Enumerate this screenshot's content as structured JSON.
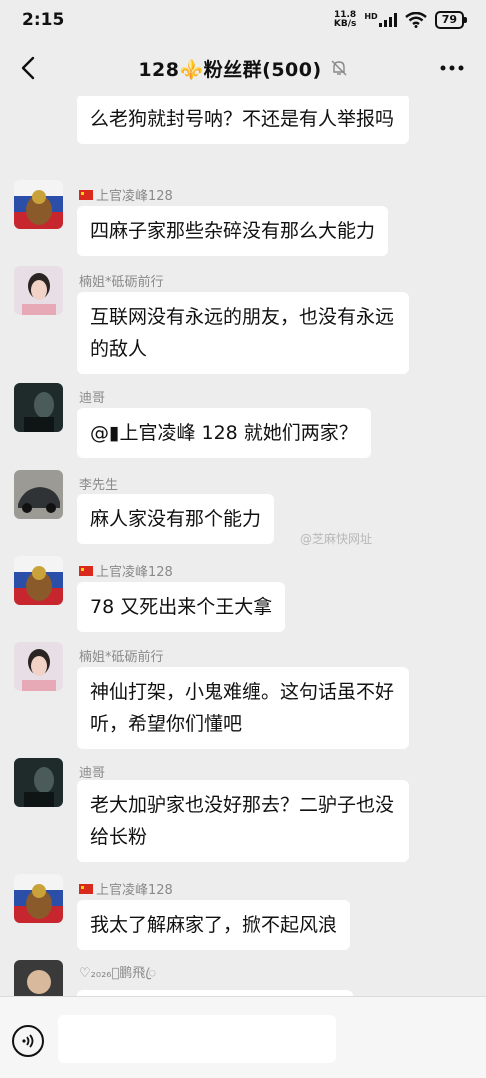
{
  "status_bar": {
    "time": "2:15",
    "net_speed_value": "11.8",
    "net_speed_unit": "KB/s",
    "network": "HD",
    "battery": "79"
  },
  "header": {
    "title": "128⚜️粉丝群(500)"
  },
  "messages": [
    {
      "sender": "",
      "text": "么老狗就封号呐？不还是有人举报吗"
    },
    {
      "sender": "上官凌峰128",
      "text": "四麻子家那些杂碎没有那么大能力"
    },
    {
      "sender": "楠姐*砥砺前行",
      "text": "互联网没有永远的朋友，也没有永远的敌人"
    },
    {
      "sender": "迪哥",
      "text": "@▮上官凌峰 128  就她们两家？"
    },
    {
      "sender": "李先生",
      "text": "麻人家没有那个能力"
    },
    {
      "sender": "上官凌峰128",
      "text": "78   又死出来个王大拿"
    },
    {
      "sender": "楠姐*砥砺前行",
      "text": "神仙打架，小鬼难缠。这句话虽不好听，希望你们懂吧"
    },
    {
      "sender": "迪哥",
      "text": "老大加驴家也没好那去？二驴子也没给长粉"
    },
    {
      "sender": "上官凌峰128",
      "text": "我太了解麻家了，掀不起风浪"
    },
    {
      "sender": "♡₂₀₂₆ꦿ鹏飛ꦿ",
      "text": ""
    }
  ],
  "watermark": "@芝麻快网址"
}
